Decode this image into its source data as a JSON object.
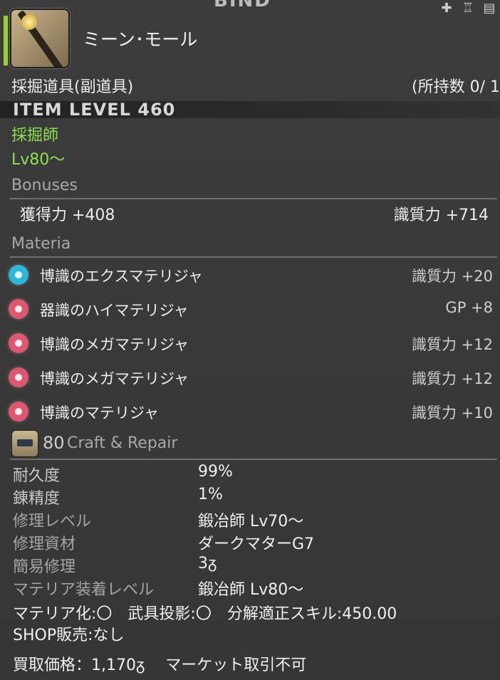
{
  "top": {
    "bind_label": "BIND",
    "icons": [
      "plus-icon",
      "mannequin-icon",
      "armory-icon"
    ]
  },
  "item": {
    "name": "ミーン･モール",
    "hq_symbol": "",
    "category": "採掘道具(副道具)",
    "owned": "所持数 0/",
    "owned_hq": "1",
    "item_level": "ITEM LEVEL 460",
    "job": "採掘師",
    "level": "Lv80～"
  },
  "bonuses": {
    "title": "Bonuses",
    "left": "獲得力 +408",
    "right": "識質力 +714"
  },
  "materia": {
    "title": "Materia",
    "items": [
      {
        "name": "博識のエクスマテリジャ",
        "stat": "識質力 +20",
        "color": "#2ab7d8"
      },
      {
        "name": "器識のハイマテリジャ",
        "stat": "GP +8",
        "color": "#e0566f"
      },
      {
        "name": "博識のメガマテリジャ",
        "stat": "識質力 +12",
        "color": "#e0566f"
      },
      {
        "name": "博識のメガマテリジャ",
        "stat": "識質力 +12",
        "color": "#e0566f"
      },
      {
        "name": "博識のマテリジャ",
        "stat": "識質力 +10",
        "color": "#e0566f"
      }
    ]
  },
  "craft": {
    "level": "80",
    "label": "Craft & Repair",
    "rows": [
      {
        "key": "耐久度",
        "value": "99%"
      },
      {
        "key": "錬精度",
        "value": "1%"
      },
      {
        "key": "修理レベル",
        "value": "鍛冶師 Lv70～"
      },
      {
        "key": "修理資材",
        "value": "ダークマターG7"
      },
      {
        "key": "簡易修理",
        "value": "3ᵹ"
      },
      {
        "key": "マテリア装着レベル",
        "value": "鍛冶師 Lv80～"
      }
    ],
    "materia_line": "マテリア化:〇　武具投影:〇　分解適正スキル:450.00",
    "shop_line": "SHOP販売:なし",
    "price_line": "買取価格：1,170ᵹ　 マーケット取引不可"
  },
  "colors": {
    "green": "#8ee04c",
    "background": "#3a3a3a"
  }
}
